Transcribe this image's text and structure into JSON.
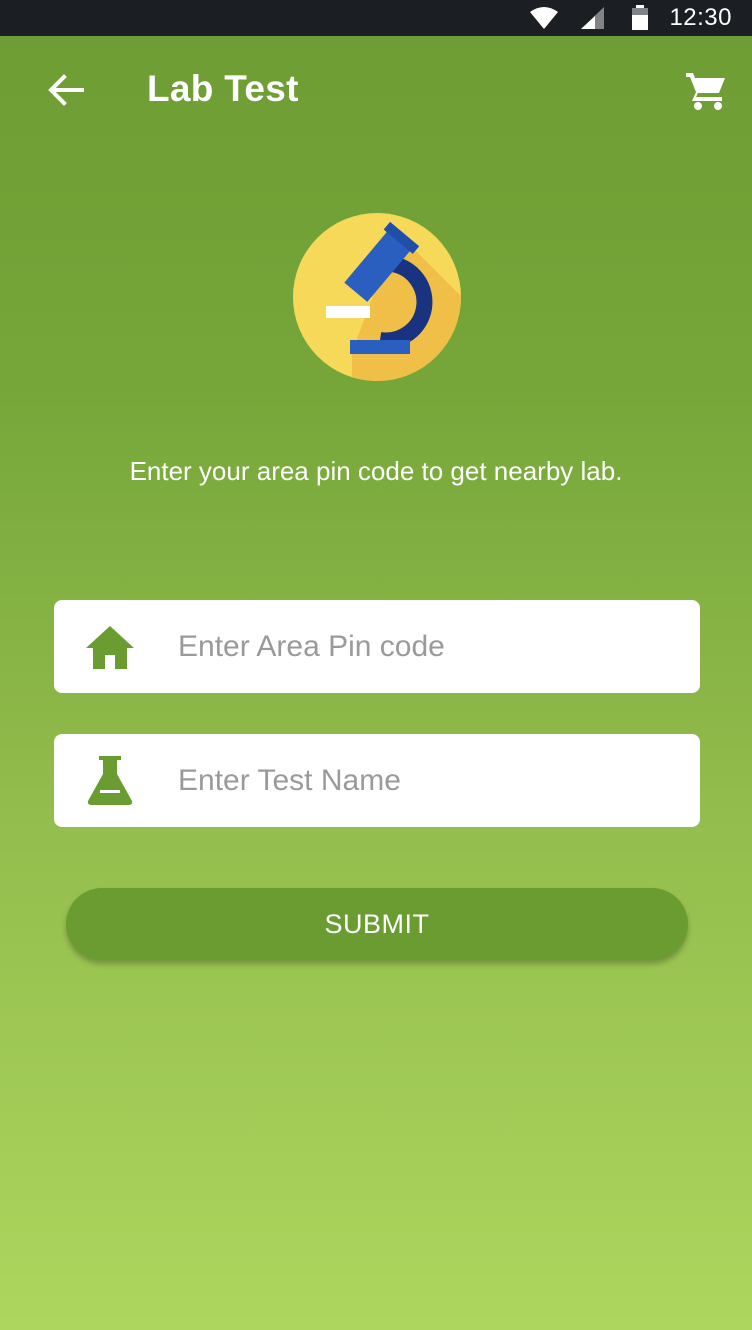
{
  "status_bar": {
    "time": "12:30",
    "icons": [
      "wifi-icon",
      "signal-icon",
      "battery-icon"
    ]
  },
  "app_bar": {
    "title": "Lab Test",
    "back_icon": "arrow-left-icon",
    "cart_icon": "cart-icon"
  },
  "hero": {
    "icon": "microscope-icon"
  },
  "subtitle": "Enter your area pin code to get nearby lab.",
  "form": {
    "pin_field": {
      "icon": "home-icon",
      "placeholder": "Enter Area Pin code",
      "value": ""
    },
    "test_field": {
      "icon": "flask-icon",
      "placeholder": "Enter Test Name",
      "value": ""
    },
    "submit_label": "SUBMIT"
  },
  "colors": {
    "status_bar": "#1b1e23",
    "background_top": "#6c9c33",
    "background_bottom": "#add65e",
    "accent_green": "#6b9c32",
    "field_background": "#ffffff",
    "placeholder": "#9a9a9a",
    "hero_circle": "#f7d95a",
    "microscope_blue": "#2a5fc0",
    "microscope_navy": "#1a3380"
  }
}
